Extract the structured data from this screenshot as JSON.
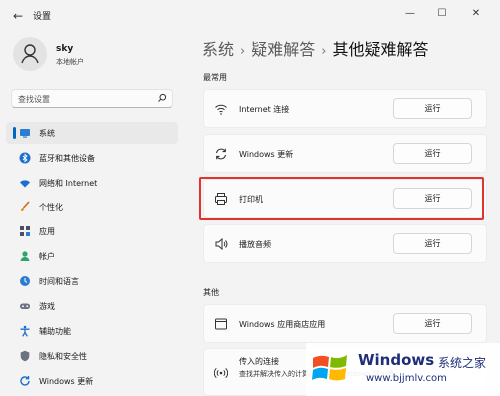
{
  "window": {
    "title": "设置",
    "back": "←",
    "minimize": "—",
    "maximize": "☐",
    "close": "✕"
  },
  "account": {
    "name": "sky",
    "type": "本地帐户"
  },
  "search": {
    "placeholder": "查找设置"
  },
  "sidebar": {
    "items": [
      {
        "label": "系统",
        "icon": "system-icon",
        "active": true
      },
      {
        "label": "蓝牙和其他设备",
        "icon": "bluetooth-icon"
      },
      {
        "label": "网络和 Internet",
        "icon": "wifi-icon"
      },
      {
        "label": "个性化",
        "icon": "brush-icon"
      },
      {
        "label": "应用",
        "icon": "apps-icon"
      },
      {
        "label": "帐户",
        "icon": "account-icon"
      },
      {
        "label": "时间和语言",
        "icon": "globe-clock-icon"
      },
      {
        "label": "游戏",
        "icon": "gamepad-icon"
      },
      {
        "label": "辅助功能",
        "icon": "accessibility-icon"
      },
      {
        "label": "隐私和安全性",
        "icon": "shield-icon"
      },
      {
        "label": "Windows 更新",
        "icon": "windows-update-icon"
      }
    ]
  },
  "breadcrumb": {
    "items": [
      "系统",
      "疑难解答",
      "其他疑难解答"
    ],
    "separator": "›"
  },
  "sections": {
    "common": {
      "label": "最常用",
      "items": [
        {
          "label": "Internet 连接",
          "icon": "wifi-icon",
          "button": "运行"
        },
        {
          "label": "Windows 更新",
          "icon": "refresh-icon",
          "button": "运行"
        },
        {
          "label": "打印机",
          "icon": "printer-icon",
          "button": "运行"
        },
        {
          "label": "播放音频",
          "icon": "speaker-icon",
          "button": "运行"
        }
      ]
    },
    "other": {
      "label": "其他",
      "items": [
        {
          "label": "Windows 应用商店应用",
          "icon": "store-app-icon",
          "button": "运行"
        },
        {
          "label": "传入的连接",
          "sublabel": "查找并解决传入的计算机连接和 Windows 防火墙",
          "icon": "incoming-connection-icon"
        }
      ]
    }
  },
  "watermark": {
    "title": "Windows",
    "cn": "系统之家",
    "url": "www.bjjmlv.com"
  },
  "colors": {
    "accent": "#0067c0",
    "highlight": "#e0332f",
    "background": "#f3f3f3"
  }
}
